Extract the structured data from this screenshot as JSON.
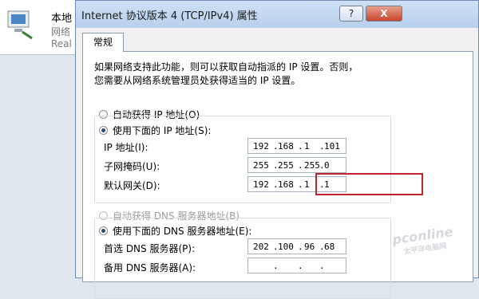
{
  "background_window": {
    "title": "本地",
    "line2": "网络",
    "line3": "Real"
  },
  "dialog": {
    "title": "Internet 协议版本 4 (TCP/IPv4) 属性",
    "help_label": "?",
    "close_label": "X",
    "tab": "常规",
    "description": [
      "如果网络支持此功能，则可以获取自动指派的 IP 设置。否则，",
      "您需要从网络系统管理员处获得适当的 IP 设置。"
    ],
    "ip_section": {
      "auto_label": "自动获得 IP 地址(O)",
      "manual_label": "使用下面的 IP 地址(S):",
      "selected": "manual",
      "fields": [
        {
          "label": "IP 地址(I):",
          "octets": [
            "192",
            "168",
            "1",
            "101"
          ]
        },
        {
          "label": "子网掩码(U):",
          "octets": [
            "255",
            "255",
            "255",
            "0"
          ]
        },
        {
          "label": "默认网关(D):",
          "octets": [
            "192",
            "168",
            "1",
            "1"
          ]
        }
      ]
    },
    "dns_section": {
      "auto_label": "自动获得 DNS 服务器地址(B)",
      "manual_label": "使用下面的 DNS 服务器地址(E):",
      "selected": "manual",
      "fields": [
        {
          "label": "首选 DNS 服务器(P):",
          "octets": [
            "202",
            "100",
            "96",
            "68"
          ]
        },
        {
          "label": "备用 DNS 服务器(A):",
          "octets": [
            "",
            "",
            "",
            ""
          ]
        }
      ]
    },
    "highlight_color": "#c0232b"
  },
  "watermark": {
    "text": "pconline",
    "sub": "太平洋电脑网"
  }
}
